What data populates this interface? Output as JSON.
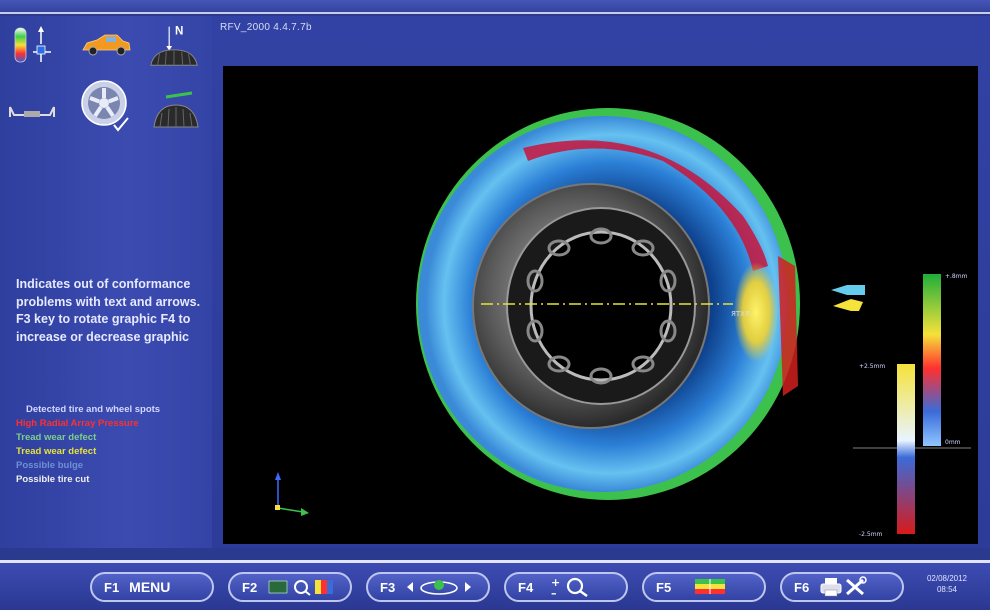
{
  "title": "RFV_2000   4.4.7.7b",
  "description": "Indicates out of conformance problems with text and arrows. F3 key to rotate graphic F4 to increase or decrease graphic",
  "legend": {
    "header": "Detected tire and wheel spots",
    "items": [
      {
        "text": "High Radial Array Pressure",
        "color": "#ff3030"
      },
      {
        "text": "Tread wear defect",
        "color": "#7ccf8a"
      },
      {
        "text": "Tread wear defect",
        "color": "#e6e23a"
      },
      {
        "text": "Possible bulge",
        "color": "#6f8fd8"
      },
      {
        "text": "Possible tire cut",
        "color": "#f0f0f0"
      }
    ]
  },
  "wheel_label": "ЯТХЯ",
  "scale_right": {
    "top": "+.8mm",
    "bottom": "0mm"
  },
  "scale_left": {
    "top": "+2.5mm",
    "bottom": "-2.5mm"
  },
  "icons": [
    "color-map-icon",
    "axis-position-icon",
    "car-icon",
    "tire-north-icon",
    "axle-icon",
    "wheel-check-icon",
    "tire-tread-icon"
  ],
  "fkeys": [
    {
      "key": "F1",
      "label": "MENU"
    },
    {
      "key": "F2",
      "label": ""
    },
    {
      "key": "F3",
      "label": ""
    },
    {
      "key": "F4",
      "label": ""
    },
    {
      "key": "F5",
      "label": ""
    },
    {
      "key": "F6",
      "label": ""
    }
  ],
  "clock": {
    "date": "02/08/2012",
    "time": "08:54"
  },
  "colors": {
    "background": "#2a3a8e",
    "viewport": "#000000",
    "accent_red": "#ff3030",
    "accent_yellow": "#f5e23a",
    "accent_green": "#3cc24c",
    "accent_blue": "#3b8bd8"
  }
}
